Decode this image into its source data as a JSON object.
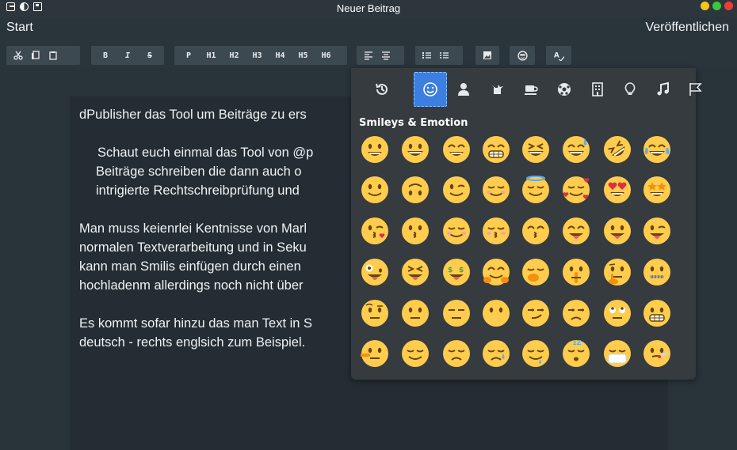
{
  "window": {
    "title": "Neuer Beitrag",
    "traffic_colors": [
      "#f5c518",
      "#3cc73c",
      "#ef3b3b"
    ]
  },
  "menu": {
    "start": "Start",
    "publish": "Veröffentlichen"
  },
  "toolbar": {
    "groups": [
      [
        "scissors-icon",
        "copy-icon",
        "paste-icon"
      ],
      [
        "B",
        "I",
        "S"
      ],
      [
        "P",
        "H1",
        "H2",
        "H3",
        "H4",
        "H5",
        "H6"
      ],
      [
        "align-left-icon",
        "align-center-icon"
      ],
      [
        "ordered-list-icon",
        "bullet-list-icon"
      ],
      [
        "image-icon"
      ],
      [
        "emoji-icon"
      ],
      [
        "spellcheck-icon"
      ]
    ],
    "labels": {
      "bold": "B",
      "italic": "I",
      "strike": "S",
      "p": "P",
      "h1": "H1",
      "h2": "H2",
      "h3": "H3",
      "h4": "H4",
      "h5": "H5",
      "h6": "H6"
    }
  },
  "document": {
    "lines": [
      "dPublisher das Tool um Beiträge zu ers",
      "",
      "Schaut euch einmal das Tool von @p",
      "Beiträge schreiben die dann auch o",
      "intrigierte Rechtschreibprüfung  und",
      "",
      "Man muss keienrlei Kentnisse von Marl",
      "normalen Textverarbeitung und in Seku",
      "kann man Smilis einfügen durch einen",
      "hochladenm allerdings noch nicht über",
      "",
      "Es kommt sofar hinzu das man Text in S",
      "deutsch -  rechts englsich zum Beispiel."
    ]
  },
  "emoji_picker": {
    "categories": [
      "recent-icon",
      "smiley-icon",
      "person-icon",
      "animal-icon",
      "food-icon",
      "activity-icon",
      "building-icon",
      "lightbulb-icon",
      "music-icon",
      "flag-icon"
    ],
    "active_category": "smiley-icon",
    "section_title": "Smileys & Emotion",
    "emojis": [
      [
        "grinning",
        "smiley",
        "smile",
        "grin",
        "laughing",
        "sweat-smile",
        "rofl",
        "joy"
      ],
      [
        "slight-smile",
        "upside-down",
        "wink",
        "blush",
        "innocent",
        "smiling-hearts",
        "heart-eyes",
        "star-struck"
      ],
      [
        "kissing-heart",
        "kissing",
        "relaxed",
        "kissing-closed-eyes",
        "kissing-smiling-eyes",
        "yum",
        "tongue",
        "zany-wink"
      ],
      [
        "zany",
        "squinting-tongue",
        "money-mouth",
        "hugging",
        "hand-over-mouth",
        "shushing",
        "thinking",
        "zipper-mouth"
      ],
      [
        "raised-eyebrow",
        "neutral",
        "expressionless",
        "no-mouth",
        "smirk",
        "unamused",
        "eye-roll",
        "grimacing"
      ],
      [
        "lying",
        "relieved",
        "pensive",
        "sleepy",
        "drooling",
        "sleeping",
        "mask",
        "thermometer"
      ]
    ],
    "face_color": "#ffcc4d",
    "feature_color": "#664500"
  }
}
